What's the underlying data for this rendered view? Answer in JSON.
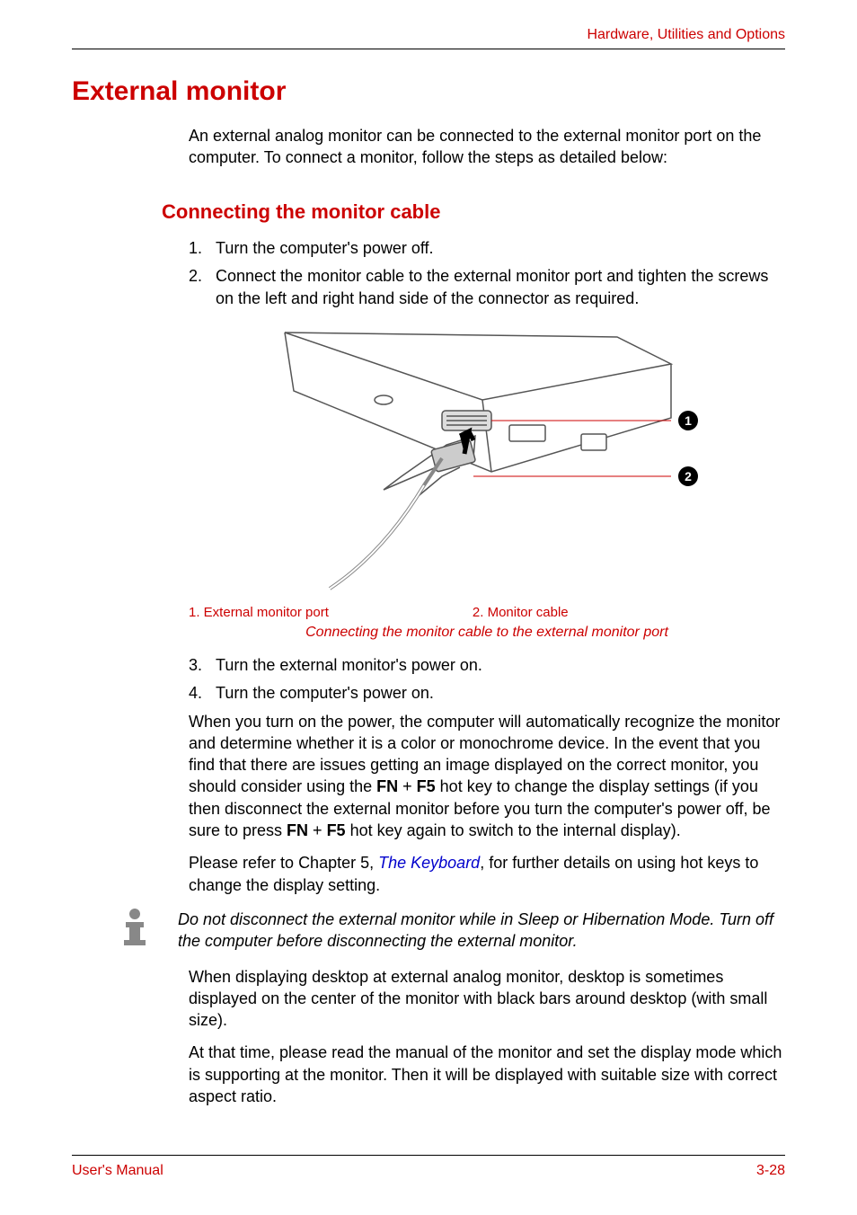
{
  "header": {
    "section": "Hardware, Utilities and Options"
  },
  "title": "External monitor",
  "intro": "An external analog monitor can be connected to the external monitor port on the computer. To connect a monitor, follow the steps as detailed below:",
  "subtitle": "Connecting the monitor cable",
  "steps12": [
    {
      "n": "1.",
      "t": "Turn the computer's power off."
    },
    {
      "n": "2.",
      "t": "Connect the monitor cable to the external monitor port and tighten the screws on the left and right hand side of the connector as required."
    }
  ],
  "callouts": {
    "c1": "1",
    "c2": "2"
  },
  "legend": {
    "l1": "1. External monitor port",
    "l2": "2. Monitor cable"
  },
  "caption": "Connecting the monitor cable to the external monitor port",
  "steps34": [
    {
      "n": "3.",
      "t": "Turn the external monitor's power on."
    },
    {
      "n": "4.",
      "t": "Turn the computer's power on."
    }
  ],
  "para1": {
    "a": "When you turn on the power, the computer will automatically recognize the monitor and determine whether it is a color or monochrome device. In the event that you find that there are issues getting an image displayed on the correct monitor, you should consider using the ",
    "fn1": "FN",
    "plus1": " + ",
    "f51": "F5",
    "b": " hot key to change the display settings (if you then disconnect the external monitor before you turn the computer's power off, be sure to press ",
    "fn2": "FN",
    "plus2": " + ",
    "f52": "F5",
    "c": " hot key again to switch to the internal display)."
  },
  "para2": {
    "a": "Please refer to Chapter 5, ",
    "link": "The Keyboard",
    "b": ", for further details on using hot keys to change the display setting."
  },
  "note": "Do not disconnect the external monitor while in Sleep or Hibernation Mode. Turn off the computer before disconnecting the external monitor.",
  "para3": "When displaying desktop at external analog monitor, desktop is sometimes displayed on the center of the monitor with black bars around desktop (with small size).",
  "para4": "At that time, please read the manual of the monitor and set the display mode which is supporting at the monitor. Then it will be displayed with suitable size with correct aspect ratio.",
  "footer": {
    "left": "User's Manual",
    "right": "3-28"
  }
}
